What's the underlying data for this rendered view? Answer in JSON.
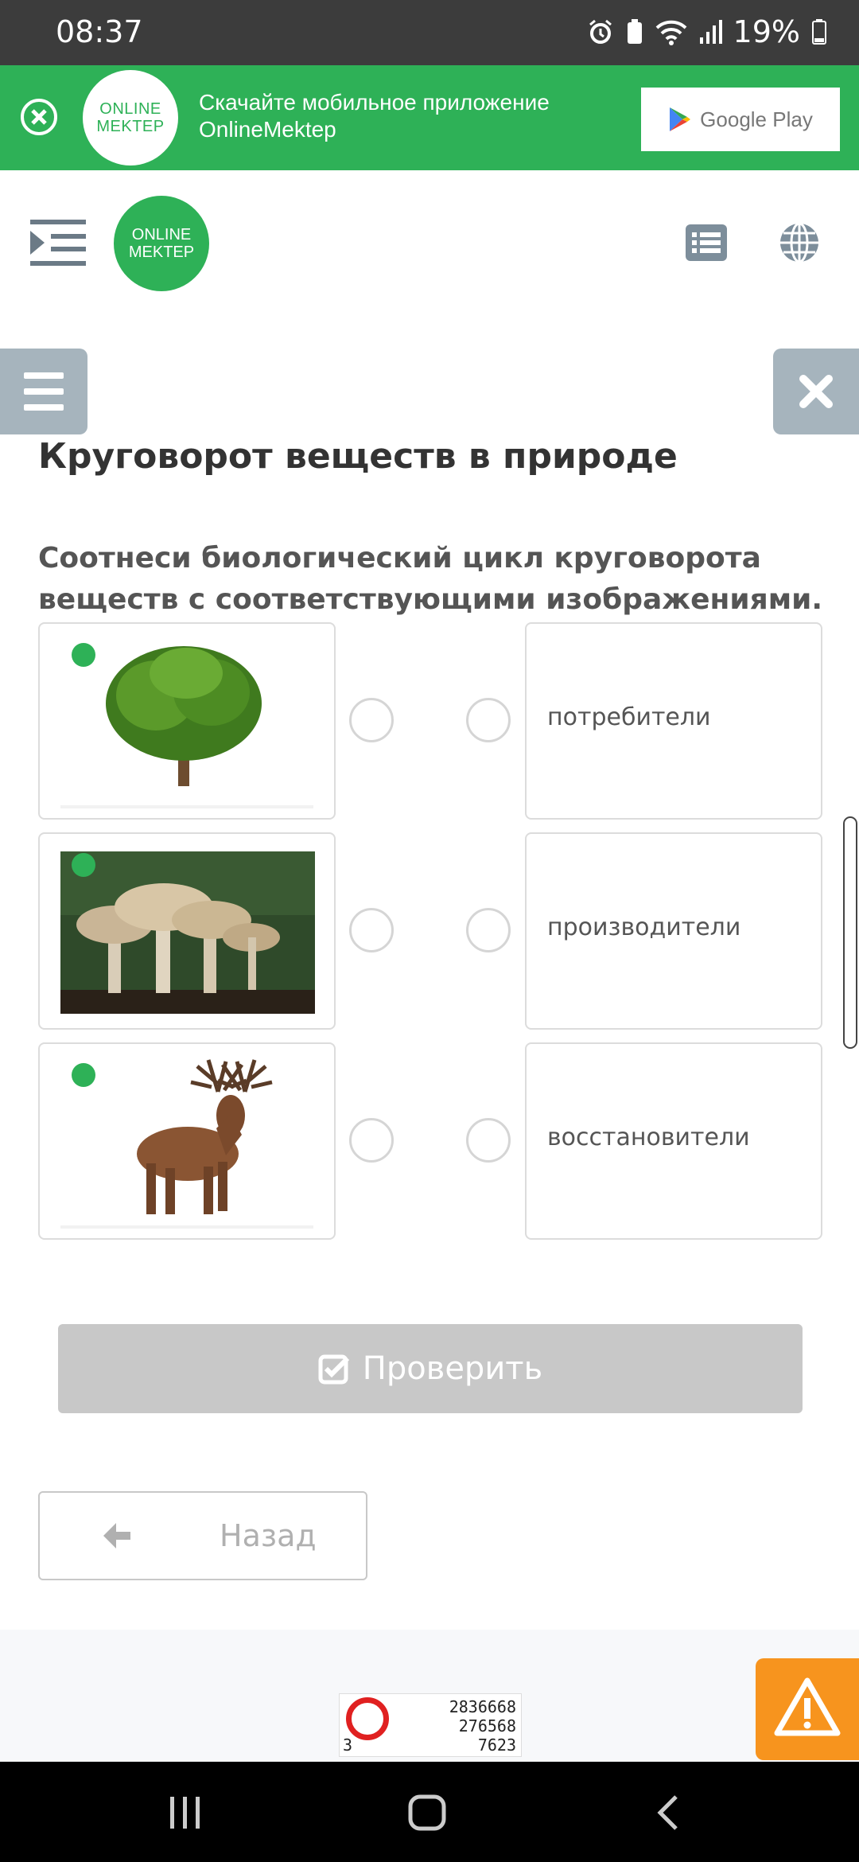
{
  "status_bar": {
    "time": "08:37",
    "battery": "19%"
  },
  "banner": {
    "logo_line1": "ONLINE",
    "logo_line2": "MEKTEP",
    "text": "Скачайте мобильное приложение OnlineMektep",
    "store_label": "Google Play"
  },
  "header": {
    "logo_line1": "ONLINE",
    "logo_line2": "MEKTEP"
  },
  "page": {
    "title": "Круговорот веществ в природе",
    "question": "Соотнеси биологический цикл круговорота веществ с соответствующими изображениями."
  },
  "match": {
    "images": [
      "tree-image",
      "mushrooms-image",
      "deer-image"
    ],
    "options": [
      {
        "label": "потребители"
      },
      {
        "label": "производители"
      },
      {
        "label": "восстановители"
      }
    ]
  },
  "buttons": {
    "check": "Проверить",
    "back": "Назад"
  },
  "counter": {
    "values": [
      "2836668",
      "276568",
      "7623"
    ],
    "left_value": "3"
  },
  "colors": {
    "brand_green": "#2eb157",
    "disabled_gray": "#c8c8c8",
    "warn_orange": "#f7941e"
  }
}
